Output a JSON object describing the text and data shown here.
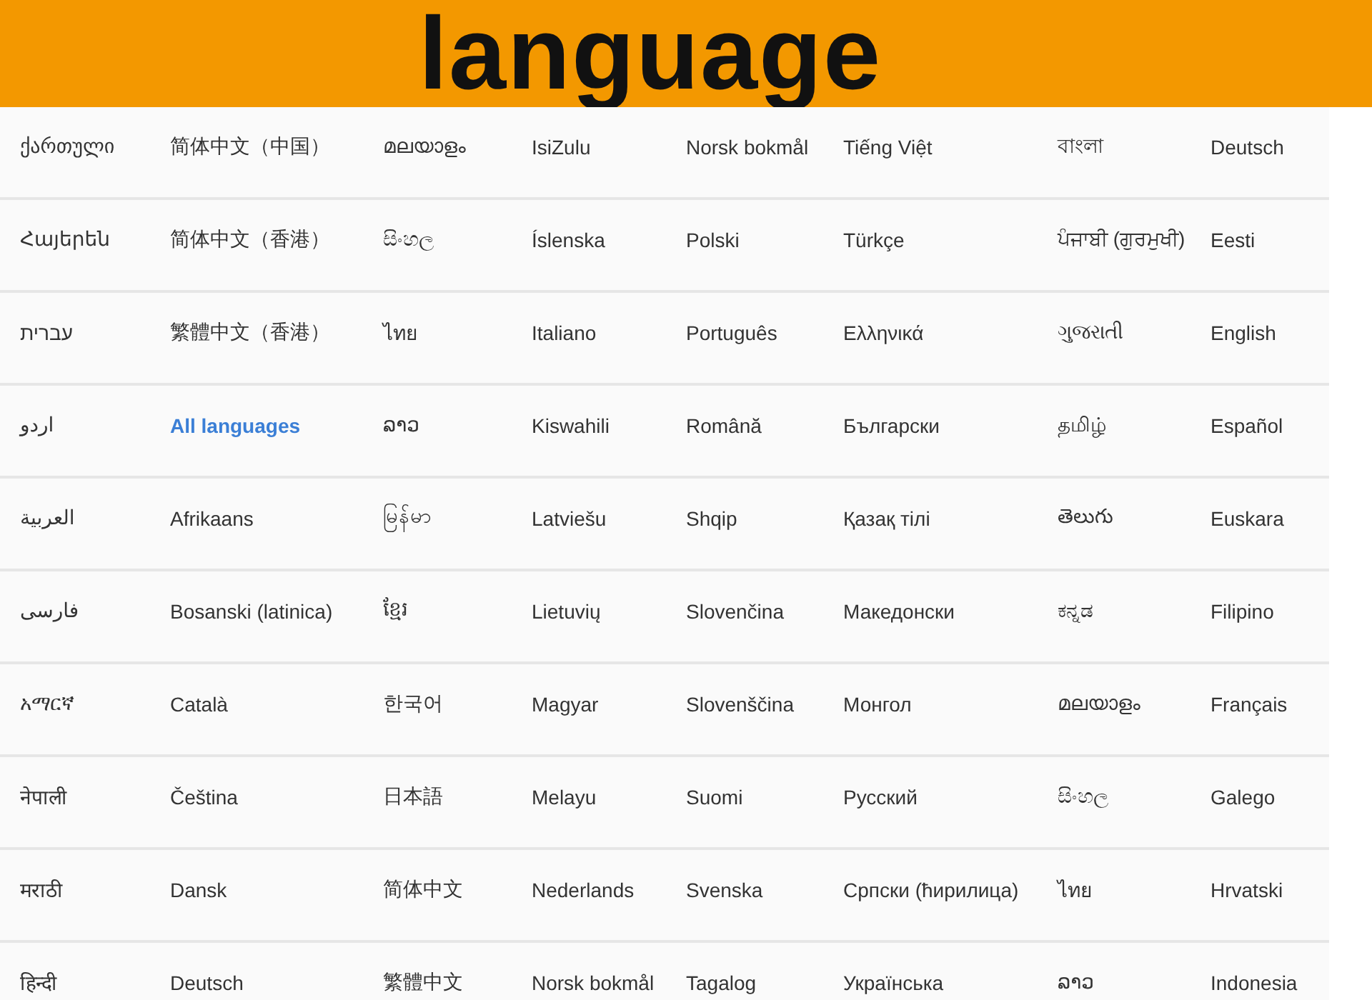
{
  "banner": {
    "title": "language"
  },
  "columns": [
    {
      "items": [
        {
          "label": "ქართული",
          "kind": "language"
        },
        {
          "label": "Հայերեն",
          "kind": "language"
        },
        {
          "label": "עברית",
          "kind": "language"
        },
        {
          "label": "اردو",
          "kind": "language"
        },
        {
          "label": "العربية",
          "kind": "language"
        },
        {
          "label": "فارسی",
          "kind": "language"
        },
        {
          "label": "አማርኛ",
          "kind": "language"
        },
        {
          "label": "नेपाली",
          "kind": "language"
        },
        {
          "label": "मराठी",
          "kind": "language"
        },
        {
          "label": "हिन्दी",
          "kind": "language"
        }
      ]
    },
    {
      "items": [
        {
          "label": "简体中文（中国）",
          "kind": "language"
        },
        {
          "label": "简体中文（香港）",
          "kind": "language"
        },
        {
          "label": "繁體中文（香港）",
          "kind": "language"
        },
        {
          "label": "All languages",
          "kind": "link"
        },
        {
          "label": "Afrikaans",
          "kind": "language"
        },
        {
          "label": "Bosanski (latinica)",
          "kind": "language"
        },
        {
          "label": "Català",
          "kind": "language"
        },
        {
          "label": "Čeština",
          "kind": "language"
        },
        {
          "label": "Dansk",
          "kind": "language"
        },
        {
          "label": "Deutsch",
          "kind": "language"
        }
      ]
    },
    {
      "items": [
        {
          "label": "മലയാളം",
          "kind": "language"
        },
        {
          "label": "සිංහල",
          "kind": "language"
        },
        {
          "label": "ไทย",
          "kind": "language"
        },
        {
          "label": "ລາວ",
          "kind": "language"
        },
        {
          "label": "မြန်မာ",
          "kind": "language"
        },
        {
          "label": "ខ្មែរ",
          "kind": "language"
        },
        {
          "label": "한국어",
          "kind": "language"
        },
        {
          "label": "日本語",
          "kind": "language"
        },
        {
          "label": "简体中文",
          "kind": "language"
        },
        {
          "label": "繁體中文",
          "kind": "language"
        }
      ]
    },
    {
      "items": [
        {
          "label": "IsiZulu",
          "kind": "language"
        },
        {
          "label": "Íslenska",
          "kind": "language"
        },
        {
          "label": "Italiano",
          "kind": "language"
        },
        {
          "label": "Kiswahili",
          "kind": "language"
        },
        {
          "label": "Latviešu",
          "kind": "language"
        },
        {
          "label": "Lietuvių",
          "kind": "language"
        },
        {
          "label": "Magyar",
          "kind": "language"
        },
        {
          "label": "Melayu",
          "kind": "language"
        },
        {
          "label": "Nederlands",
          "kind": "language"
        },
        {
          "label": "Norsk bokmål",
          "kind": "language"
        }
      ]
    },
    {
      "items": [
        {
          "label": "Norsk bokmål",
          "kind": "language"
        },
        {
          "label": "Polski",
          "kind": "language"
        },
        {
          "label": "Português",
          "kind": "language"
        },
        {
          "label": "Română",
          "kind": "language"
        },
        {
          "label": "Shqip",
          "kind": "language"
        },
        {
          "label": "Slovenčina",
          "kind": "language"
        },
        {
          "label": "Slovenščina",
          "kind": "language"
        },
        {
          "label": "Suomi",
          "kind": "language"
        },
        {
          "label": "Svenska",
          "kind": "language"
        },
        {
          "label": "Tagalog",
          "kind": "language"
        }
      ]
    },
    {
      "items": [
        {
          "label": "Tiếng Việt",
          "kind": "language"
        },
        {
          "label": "Türkçe",
          "kind": "language"
        },
        {
          "label": "Ελληνικά",
          "kind": "language"
        },
        {
          "label": "Български",
          "kind": "language"
        },
        {
          "label": "Қазақ тілі",
          "kind": "language"
        },
        {
          "label": "Македонски",
          "kind": "language"
        },
        {
          "label": "Монгол",
          "kind": "language"
        },
        {
          "label": "Русский",
          "kind": "language"
        },
        {
          "label": "Српски (ћирилица)",
          "kind": "language"
        },
        {
          "label": "Українська",
          "kind": "language"
        }
      ]
    },
    {
      "items": [
        {
          "label": "বাংলা",
          "kind": "language"
        },
        {
          "label": "ਪੰਜਾਬੀ (ਗੁਰਮੁਖੀ)",
          "kind": "language"
        },
        {
          "label": "ગુજરાતી",
          "kind": "language"
        },
        {
          "label": "தமிழ்",
          "kind": "language"
        },
        {
          "label": "తెలుగు",
          "kind": "language"
        },
        {
          "label": "ಕನ್ನಡ",
          "kind": "language"
        },
        {
          "label": "മലയാളം",
          "kind": "language"
        },
        {
          "label": "සිංහල",
          "kind": "language"
        },
        {
          "label": "ไทย",
          "kind": "language"
        },
        {
          "label": "ລາວ",
          "kind": "language"
        }
      ]
    },
    {
      "items": [
        {
          "label": "Deutsch",
          "kind": "language"
        },
        {
          "label": "Eesti",
          "kind": "language"
        },
        {
          "label": "English",
          "kind": "language"
        },
        {
          "label": "Español",
          "kind": "language"
        },
        {
          "label": "Euskara",
          "kind": "language"
        },
        {
          "label": "Filipino",
          "kind": "language"
        },
        {
          "label": "Français",
          "kind": "language"
        },
        {
          "label": "Galego",
          "kind": "language"
        },
        {
          "label": "Hrvatski",
          "kind": "language"
        },
        {
          "label": "Indonesia",
          "kind": "language"
        }
      ]
    }
  ]
}
